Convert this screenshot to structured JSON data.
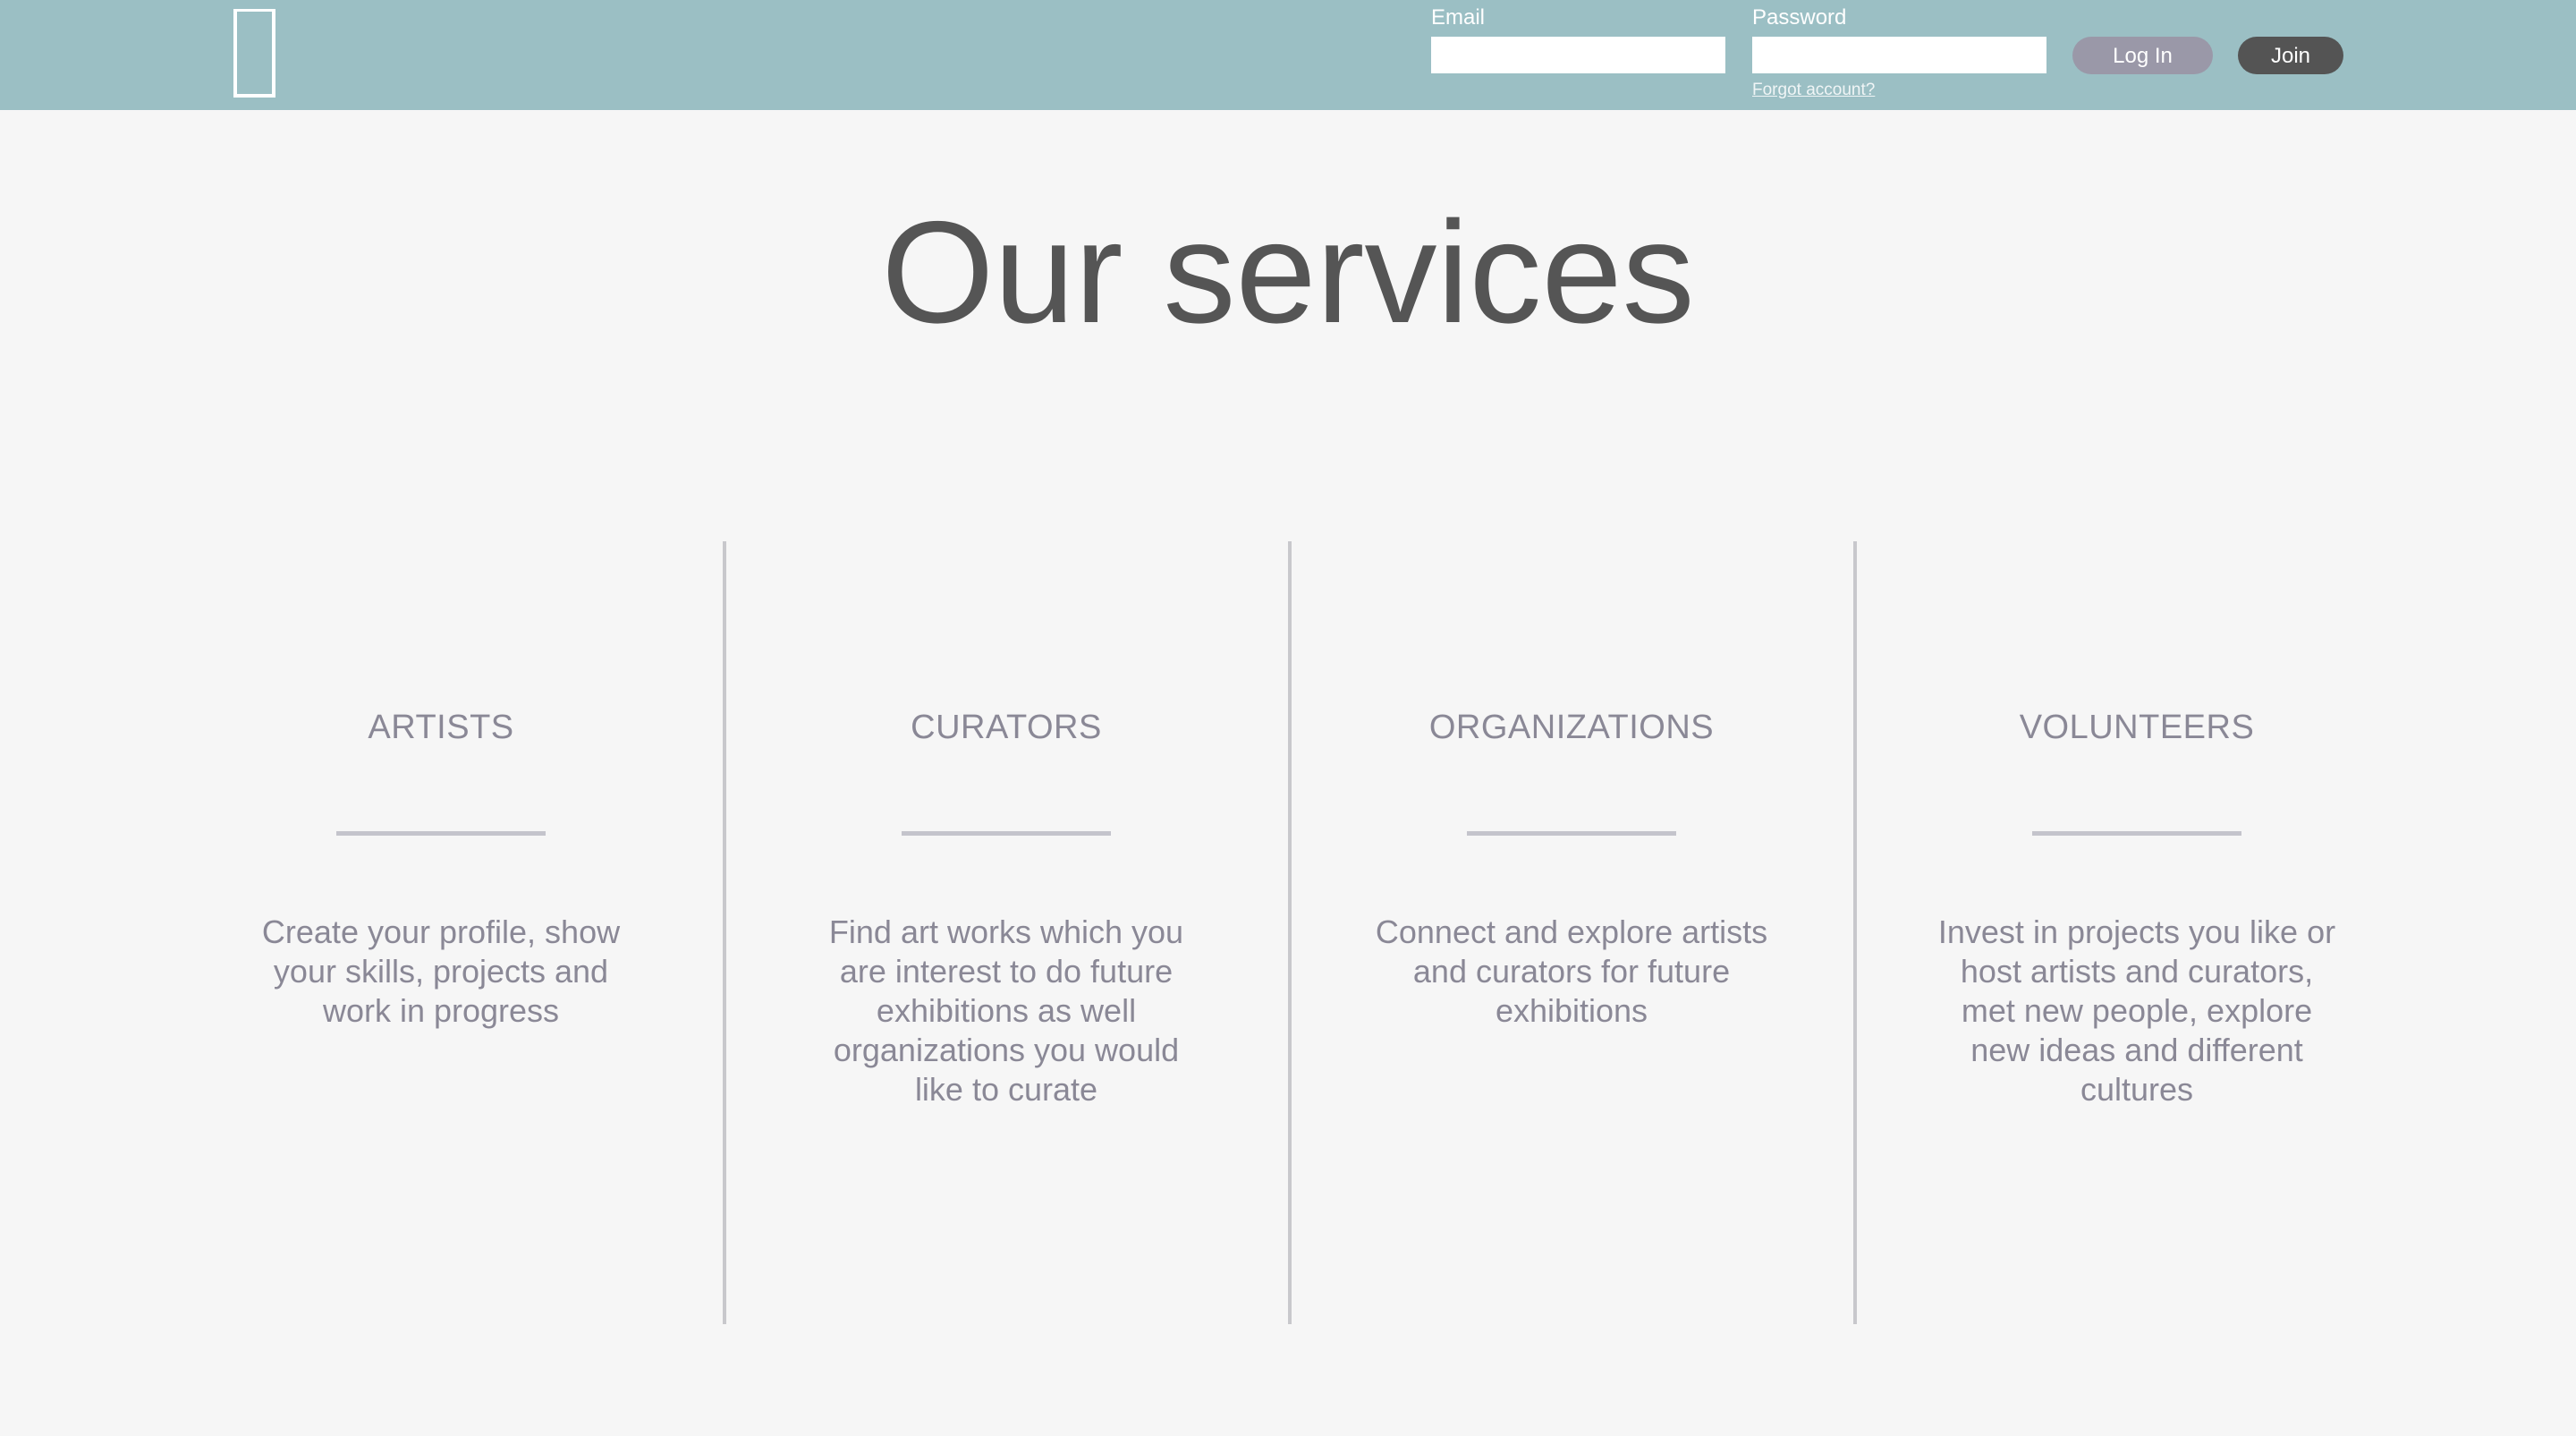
{
  "header": {
    "email_label": "Email",
    "email_value": "",
    "password_label": "Password",
    "password_value": "",
    "forgot_link": "Forgot account?",
    "login_label": "Log In",
    "join_label": "Join",
    "logo_icon": "door-outline-logo"
  },
  "main": {
    "title": "Our services",
    "services": [
      {
        "heading": "ARTISTS",
        "description": "Create your profile, show your skills, projects and work in progress"
      },
      {
        "heading": "CURATORS",
        "description": "Find art works which you are interest to do future exhibitions as well organizations you would like to curate"
      },
      {
        "heading": "ORGANIZATIONS",
        "description": "Connect and explore artists and curators for future exhibitions"
      },
      {
        "heading": "VOLUNTEERS",
        "description": "Invest in projects you like or host artists and curators, met new people, explore new ideas and different cultures"
      }
    ]
  },
  "colors": {
    "header_bg": "#9bbfc4",
    "page_bg": "#f6f6f6",
    "login_button": "#9a98a8",
    "join_button": "#545454",
    "text_muted": "#8a8896"
  }
}
